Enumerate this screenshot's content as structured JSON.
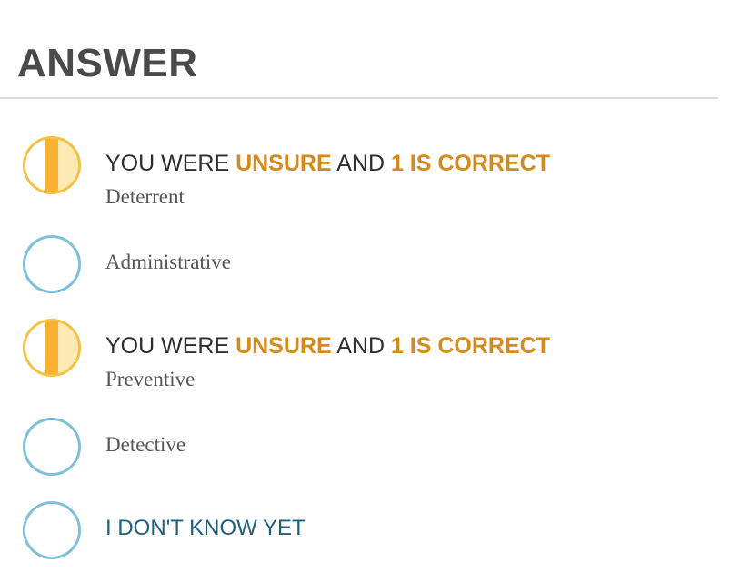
{
  "header": {
    "title": "ANSWER"
  },
  "status": {
    "prefix": "YOU WERE ",
    "confidence": "UNSURE",
    "joiner": " AND ",
    "result": "1 IS CORRECT"
  },
  "options": [
    {
      "label": "Deterrent",
      "state": "unsure"
    },
    {
      "label": "Administrative",
      "state": "empty"
    },
    {
      "label": "Preventive",
      "state": "unsure"
    },
    {
      "label": "Detective",
      "state": "empty"
    }
  ],
  "idk": {
    "label": "I DON'T KNOW YET"
  },
  "colors": {
    "title": "#4a4a4a",
    "highlight": "#d58a1a",
    "empty_ring": "#7fbfd9",
    "unsure_ring": "#f5c147",
    "unsure_fill": "#fbb12f",
    "unsure_light": "#fde9b3",
    "idk_text": "#1f5f7e"
  }
}
